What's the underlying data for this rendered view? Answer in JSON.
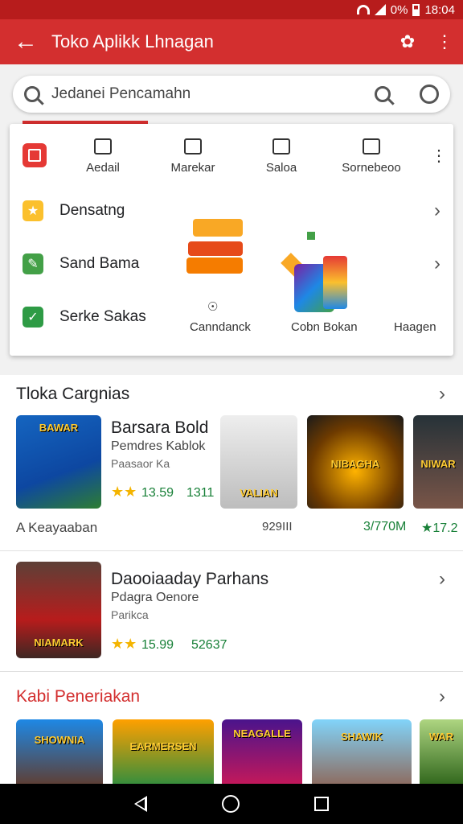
{
  "status_bar": {
    "battery": "0%",
    "time": "18:04"
  },
  "app_bar": {
    "title": "Toko Aplikk Lhnagan",
    "back_icon": "arrow-back-icon",
    "icons": [
      "share-icon",
      "more-vert-icon"
    ]
  },
  "search": {
    "placeholder": "Jedanei Pencamahn"
  },
  "categories": [
    {
      "label": "Aedail",
      "icon": "gift-icon"
    },
    {
      "label": "Marekar",
      "icon": "tag-icon"
    },
    {
      "label": "Saloa",
      "icon": "box-icon"
    },
    {
      "label": "Sornebeoo",
      "icon": "image-icon"
    }
  ],
  "menu_rows": [
    {
      "label": "Densatng",
      "icon": "star-icon",
      "color": "#fbc02d"
    },
    {
      "label": "Sand Bama",
      "icon": "edit-icon",
      "color": "#43a047"
    },
    {
      "label": "Serke Sakas",
      "icon": "check-icon",
      "color": "#2e9b45"
    }
  ],
  "sub_labels": [
    "Canndanck",
    "Cobn Bokan",
    "Haagen"
  ],
  "section1": {
    "title": "Tloka Cargnias",
    "apps": [
      {
        "title": "BAWAR",
        "footer": "A Keayaaban"
      },
      {
        "title": "VALIAN",
        "footer": "929III"
      },
      {
        "title": "NIBAGHA",
        "footer": "3/770M"
      },
      {
        "title": "NIWAR",
        "footer": "★17.2"
      }
    ],
    "featured": {
      "name": "Barsara Bold",
      "sub": "Pemdres Kablok",
      "sub2": "Paasaor Ka",
      "rating": "13.59",
      "count": "1311"
    }
  },
  "section2": {
    "app": {
      "thumb_title": "NIAMARK",
      "name": "Daooiaaday Parhans",
      "sub": "Pdagra Oenore",
      "sub2": "Parikca",
      "rating": "15.99",
      "count": "52637"
    }
  },
  "section3": {
    "title": "Kabi Peneriakan",
    "thumbs": [
      "SHOWNIA",
      "EARMERSEN",
      "NEAGALLE",
      "SHAWIK",
      "WAR"
    ]
  },
  "colors": {
    "primary": "#d32f2f",
    "status": "#b71c1c",
    "accent_red": "#e53935",
    "star": "#f4b400",
    "green": "#188038"
  }
}
